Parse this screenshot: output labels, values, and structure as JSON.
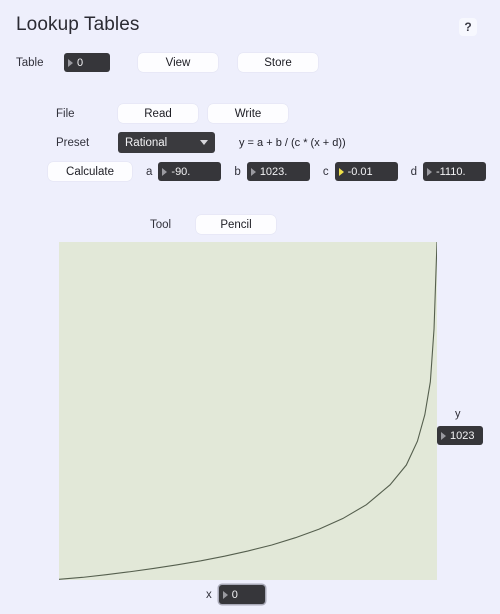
{
  "window": {
    "title": "Lookup Tables",
    "help_label": "?"
  },
  "table_row": {
    "label": "Table",
    "value": "0",
    "view_label": "View",
    "store_label": "Store"
  },
  "file_row": {
    "label": "File",
    "read_label": "Read",
    "write_label": "Write"
  },
  "preset_row": {
    "label": "Preset",
    "selected": "Rational",
    "formula": "y = a + b / (c * (x + d))"
  },
  "calculate_row": {
    "calculate_label": "Calculate",
    "params": [
      {
        "name": "a",
        "value": "-90.",
        "active": false
      },
      {
        "name": "b",
        "value": "1023.",
        "active": false
      },
      {
        "name": "c",
        "value": "-0.01",
        "active": true
      },
      {
        "name": "d",
        "value": "-1110.",
        "active": false
      }
    ]
  },
  "tool_row": {
    "label": "Tool",
    "selected": "Pencil"
  },
  "readouts": {
    "y_label": "y",
    "y_value": "1023",
    "x_label": "x",
    "x_value": "0"
  },
  "colors": {
    "page_background": "#eeeffc",
    "plot_background": "#e2e8d8",
    "field_background": "#36363a",
    "curve": "#555f4e",
    "active_marker": "#efe04a"
  },
  "chart_data": {
    "type": "line",
    "title": "",
    "xlabel": "x",
    "ylabel": "y",
    "grid": false,
    "legend": "none",
    "equation": "y = a + b / (c * (x + d))",
    "params": {
      "a": -90.0,
      "b": 1023.0,
      "c": -0.01,
      "d": -1110.0
    },
    "xlim": [
      0,
      1023
    ],
    "ylim": [
      0,
      1023
    ],
    "cursor": {
      "x": 0,
      "y": 1023
    },
    "x": [
      0,
      64,
      128,
      192,
      256,
      320,
      384,
      448,
      512,
      576,
      640,
      704,
      768,
      832,
      896,
      940,
      970,
      990,
      1005,
      1015,
      1023
    ],
    "y": [
      2,
      8,
      16,
      25,
      35,
      46,
      58,
      72,
      88,
      106,
      128,
      154,
      186,
      228,
      288,
      348,
      420,
      500,
      600,
      760,
      1023
    ]
  }
}
